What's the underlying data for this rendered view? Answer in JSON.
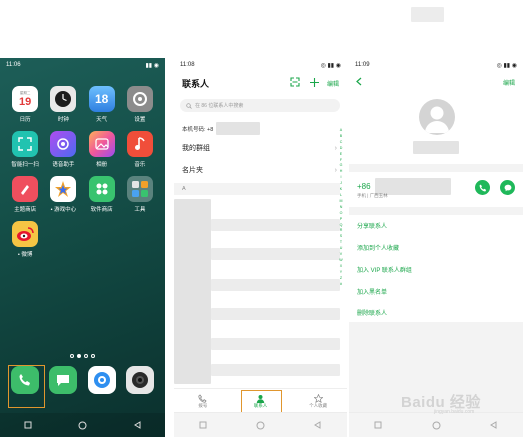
{
  "screen1": {
    "time": "11:06",
    "date_icon_text": "19",
    "date_icon_week": "星期二",
    "weather_icon_text": "18",
    "apps": [
      {
        "label": "日历",
        "icon": "calendar-icon",
        "color": "#ffffff"
      },
      {
        "label": "时钟",
        "icon": "clock-icon",
        "color": "#e9e9e9"
      },
      {
        "label": "天气",
        "icon": "weather-icon",
        "color": "#4aa2f0"
      },
      {
        "label": "设置",
        "icon": "settings-icon",
        "color": "#8c8c8c"
      },
      {
        "label": "智能扫一扫",
        "icon": "scan-icon",
        "color": "#21c3b0"
      },
      {
        "label": "语音助手",
        "icon": "voice-assistant-icon",
        "color": "#7c4cf0"
      },
      {
        "label": "相册",
        "icon": "gallery-icon",
        "color": "#f06aa0"
      },
      {
        "label": "音乐",
        "icon": "music-icon",
        "color": "#f04e3a"
      },
      {
        "label": "主题商店",
        "icon": "theme-store-icon",
        "color": "#ef4f5e"
      },
      {
        "label": "游戏中心",
        "icon": "game-center-icon",
        "color": "#ffffff"
      },
      {
        "label": "软件商店",
        "icon": "app-store-icon",
        "color": "#39c36f"
      },
      {
        "label": "工具",
        "icon": "tools-folder-icon",
        "color": "#6f8a86"
      },
      {
        "label": "微博",
        "icon": "weibo-icon",
        "color": "#f5c544"
      }
    ],
    "dock": [
      {
        "icon": "phone-icon",
        "color": "#3dbd6a"
      },
      {
        "icon": "messages-icon",
        "color": "#3dbd6a"
      },
      {
        "icon": "browser-icon",
        "color": "#ffffff"
      },
      {
        "icon": "camera-icon",
        "color": "#2a2a2a"
      }
    ]
  },
  "screen2": {
    "time": "11:08",
    "title": "联系人",
    "edit_label": "编辑",
    "search_placeholder": "在 86 位联系人中搜索",
    "my_number_label": "本机号码: +8",
    "rows": [
      {
        "label": "我的群组",
        "arrow": "›"
      },
      {
        "label": "名片夹",
        "arrow": "›"
      }
    ],
    "section_letter": "A",
    "alphabet": [
      "A",
      "B",
      "C",
      "D",
      "E",
      "F",
      "G",
      "H",
      "I",
      "J",
      "K",
      "L",
      "M",
      "N",
      "O",
      "P",
      "Q",
      "R",
      "S",
      "T",
      "U",
      "V",
      "W",
      "X",
      "Y",
      "Z",
      "#"
    ],
    "tabs": [
      {
        "label": "拨号",
        "icon": "dialpad-tab-icon",
        "active": false
      },
      {
        "label": "联系人",
        "icon": "contacts-tab-icon",
        "active": true
      },
      {
        "label": "个人收藏",
        "icon": "favorites-tab-icon",
        "active": false
      }
    ],
    "accent": "#1aa64a",
    "highlight": "#e0962e"
  },
  "screen3": {
    "time": "11:09",
    "edit_label": "编辑",
    "phone_prefix": "+86",
    "phone_meta": "手机 | 广西玉林",
    "actions": [
      "分享联系人",
      "添加到个人收藏",
      "加入 VIP 联系人群组",
      "加入黑名单",
      "删除联系人"
    ]
  },
  "watermark": {
    "main": "Baidu 经验",
    "sub": "jingyan.baidu.com"
  }
}
